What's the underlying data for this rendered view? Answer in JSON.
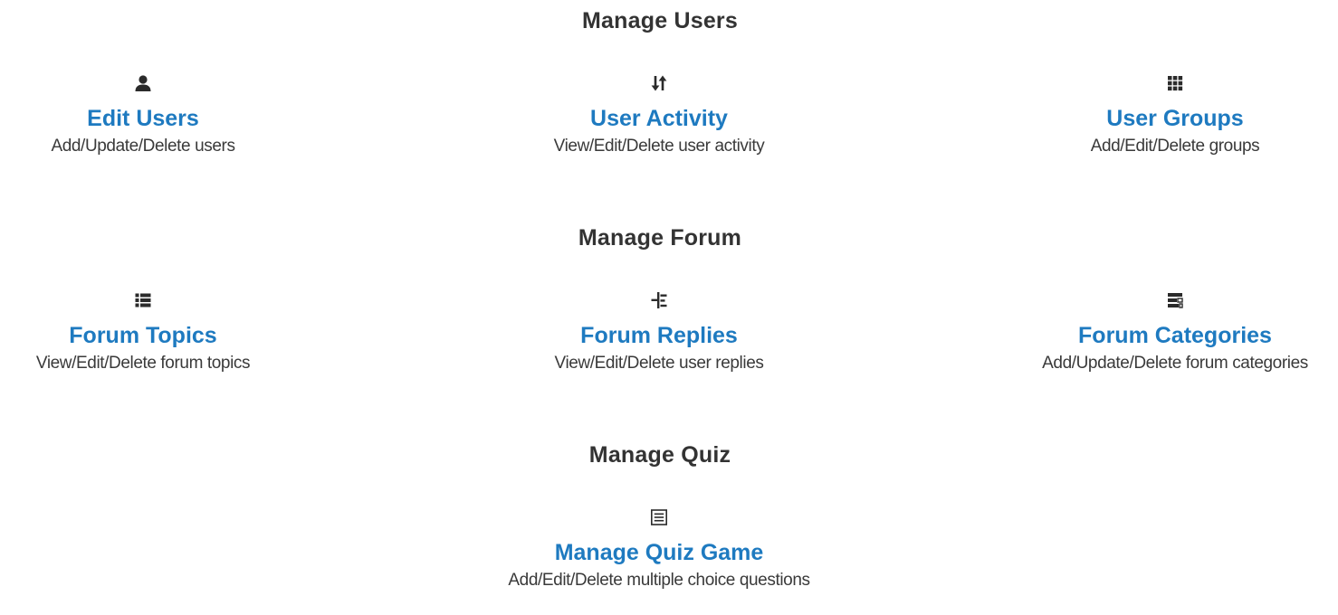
{
  "sections": [
    {
      "title": "Manage Users",
      "items": [
        {
          "icon": "user-icon",
          "title": "Edit Users",
          "desc": "Add/Update/Delete users"
        },
        {
          "icon": "sort-arrows-icon",
          "title": "User Activity",
          "desc": "View/Edit/Delete user activity"
        },
        {
          "icon": "grid-icon",
          "title": "User Groups",
          "desc": "Add/Edit/Delete groups"
        }
      ]
    },
    {
      "title": "Manage Forum",
      "items": [
        {
          "icon": "list-icon",
          "title": "Forum Topics",
          "desc": "View/Edit/Delete forum topics"
        },
        {
          "icon": "tree-icon",
          "title": "Forum Replies",
          "desc": "View/Edit/Delete user replies"
        },
        {
          "icon": "tasks-icon",
          "title": "Forum Categories",
          "desc": "Add/Update/Delete forum categories"
        }
      ]
    },
    {
      "title": "Manage Quiz",
      "items": [
        {
          "icon": "list-alt-icon",
          "title": "Manage Quiz Game",
          "desc": "Add/Edit/Delete multiple choice questions"
        }
      ]
    }
  ],
  "colors": {
    "link": "#1e7ac0",
    "heading": "#333333",
    "text": "#3a3a3a",
    "icon": "#2b2b2b"
  }
}
